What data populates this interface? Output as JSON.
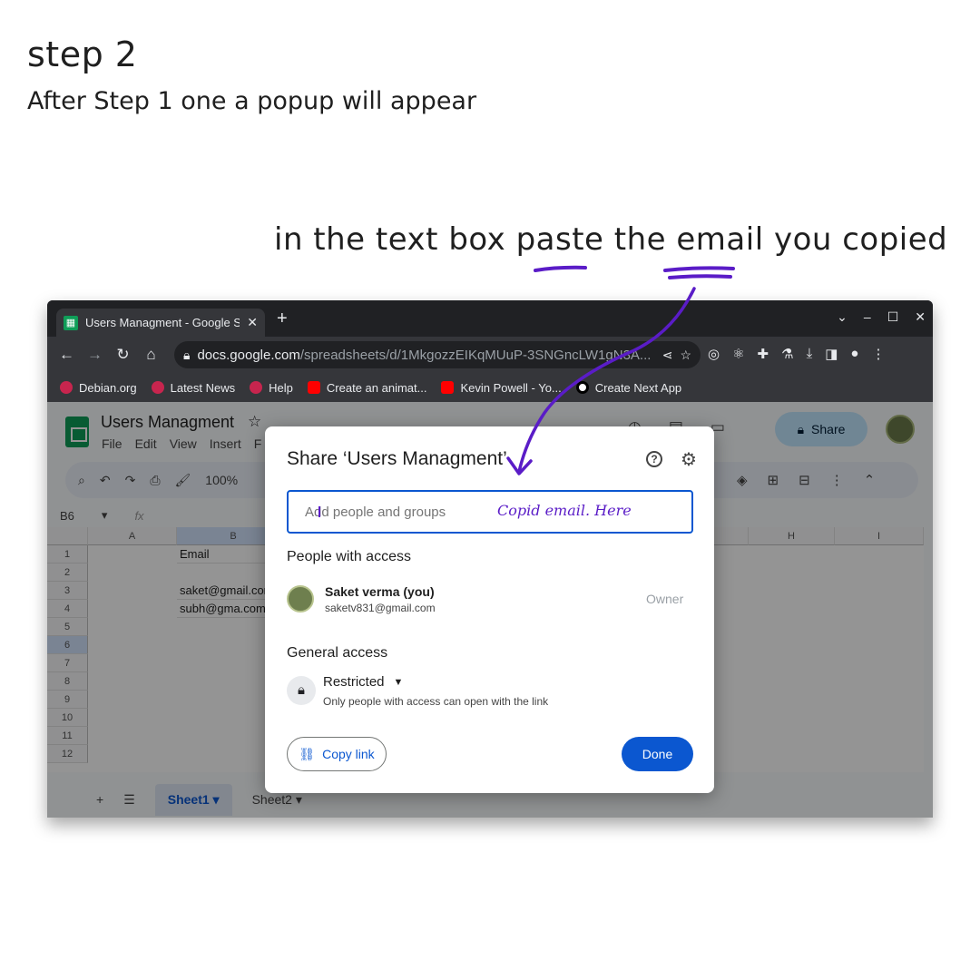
{
  "annotation": {
    "step_title": "step 2",
    "step_subtitle": "After Step 1 one a popup will appear",
    "instruction": "in the text box paste the email you copied",
    "handwritten_hint": "Copid email. Here",
    "ink_color": "#5a1cc7"
  },
  "browser": {
    "tab_title": "Users Managment - Google S",
    "new_tab": "+",
    "url_host": "docs.google.com",
    "url_path": "/spreadsheets/d/1MkgozzEIKqMUuP-3SNGncLW1gN3A...",
    "bookmarks": [
      {
        "label": "Debian.org",
        "icon": "debian-icon"
      },
      {
        "label": "Latest News",
        "icon": "debian-icon"
      },
      {
        "label": "Help",
        "icon": "debian-icon"
      },
      {
        "label": "Create an animat...",
        "icon": "youtube-icon"
      },
      {
        "label": "Kevin Powell - Yo...",
        "icon": "youtube-icon"
      },
      {
        "label": "Create Next App",
        "icon": "nextjs-icon"
      }
    ]
  },
  "sheet": {
    "doc_title": "Users Managment",
    "menus": [
      "File",
      "Edit",
      "View",
      "Insert",
      "F"
    ],
    "zoom": "100%",
    "share_label": "Share",
    "name_box": "B6",
    "formula_fx": "fx",
    "columns": [
      "A",
      "B",
      "H",
      "I"
    ],
    "rows": [
      "1",
      "2",
      "3",
      "4",
      "5",
      "6",
      "7",
      "8",
      "9",
      "10",
      "11",
      "12"
    ],
    "cells": {
      "B1": "Email",
      "B3": "saket@gmail.com",
      "B4": "subh@gma.com"
    },
    "tabs": [
      "Sheet1",
      "Sheet2"
    ]
  },
  "dialog": {
    "title": "Share ‘Users Managment’",
    "input_placeholder": "Add people and groups",
    "people_header": "People with access",
    "user_name": "Saket verma (you)",
    "user_email": "saketv831@gmail.com",
    "user_role": "Owner",
    "general_header": "General access",
    "access_level": "Restricted",
    "access_desc": "Only people with access can open with the link",
    "copy_link_label": "Copy link",
    "done_label": "Done"
  }
}
